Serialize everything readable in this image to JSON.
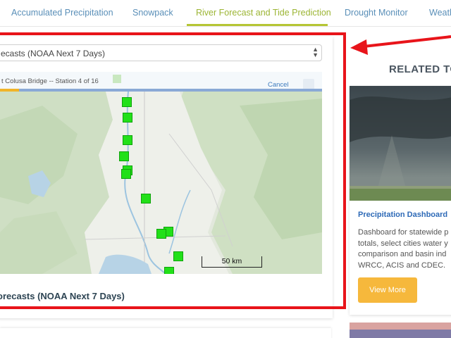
{
  "tabs": [
    {
      "label": "Accumulated Precipitation"
    },
    {
      "label": "Snowpack"
    },
    {
      "label": "River Forecast and Tide Prediction",
      "active": true
    },
    {
      "label": "Drought Monitor"
    },
    {
      "label": "Weath"
    }
  ],
  "forecast_card": {
    "select_value": "ecasts (NOAA Next 7 Days)",
    "tour_text": "t Colusa Bridge -- Station 4 of 16",
    "tour_cancel": "Cancel",
    "tour_progress": 0.06,
    "scale_label": "50 km",
    "title": "orecasts (NOAA Next 7 Days)"
  },
  "related": {
    "heading": "RELATED TO",
    "card": {
      "title": "Precipitation Dashboard",
      "description_lines": [
        "Dashboard for statewide p",
        "totals, select cities water y",
        "comparison and basin ind",
        "WRCC, ACIS and CDEC."
      ],
      "button": "View More"
    }
  },
  "colors": {
    "tab_text": "#5a8fb8",
    "tab_active": "#9cb534",
    "highlight": "#e8141a",
    "station_marker": "#22e019",
    "button": "#f6b83c",
    "link": "#2e6ab7"
  }
}
